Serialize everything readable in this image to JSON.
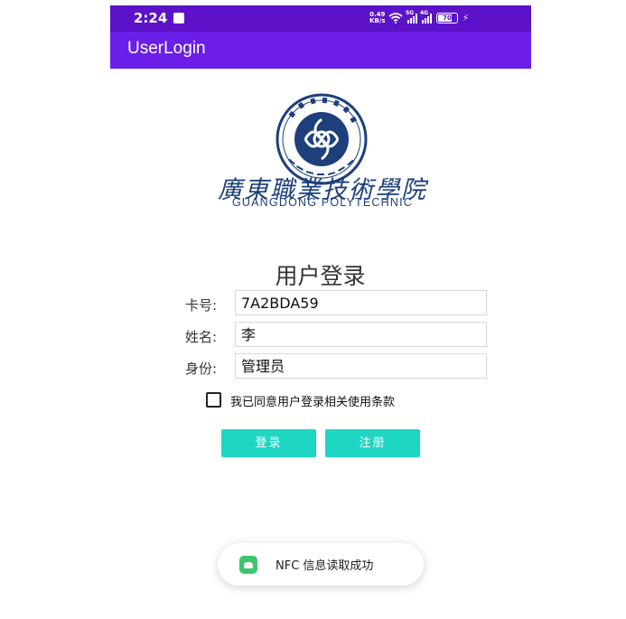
{
  "status_bar": {
    "time": "2:24",
    "network_speed_value": "0.49",
    "network_speed_unit": "KB/s",
    "signal_1_tag": "5G",
    "signal_2_tag": "4G",
    "battery": "70",
    "charging_icon": "lightning-icon"
  },
  "app_bar": {
    "title": "UserLogin"
  },
  "logo": {
    "cn_name": "廣東職業技術學院",
    "en_name": "GUANGDONG POLYTECHNIC",
    "seal_ring_text": "GUANGDONG POLYTECHNIC",
    "brand_color": "#1d3f7c"
  },
  "login_form": {
    "title": "用户登录",
    "fields": [
      {
        "label": "卡号:",
        "value": "7A2BDA59"
      },
      {
        "label": "姓名:",
        "value": "李"
      },
      {
        "label": "身份:",
        "value": "管理员"
      }
    ],
    "agree_checked": false,
    "agree_text": "我已同意用户登录相关使用条款",
    "login_button": "登录",
    "register_button": "注册"
  },
  "toast": {
    "text": "NFC 信息读取成功"
  },
  "colors": {
    "status_bar": "#5b12c9",
    "app_bar": "#6a1ee8",
    "button": "#1fd6c3"
  }
}
